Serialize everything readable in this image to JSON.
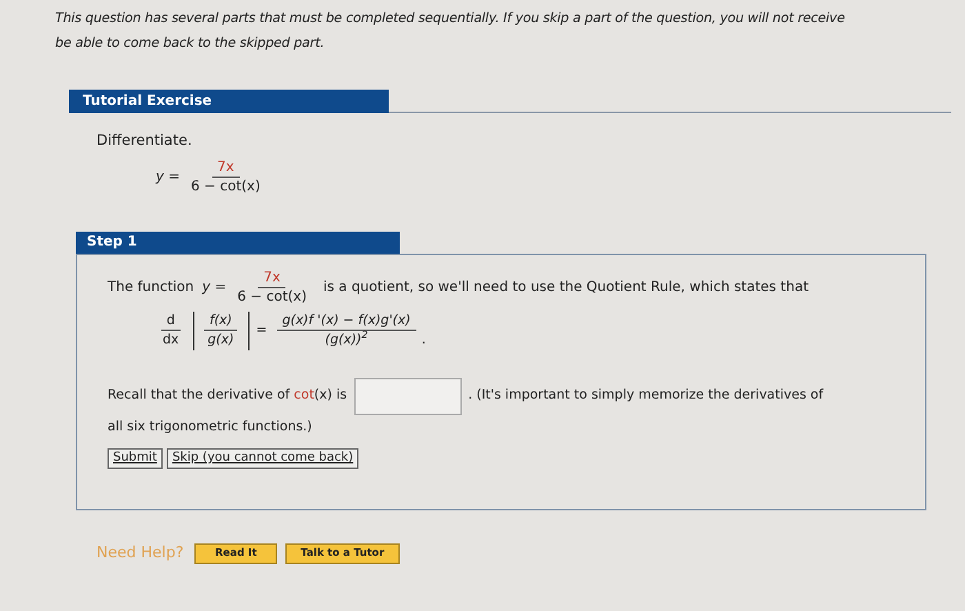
{
  "notice": [
    "This question has several parts that must be completed sequentially. If you skip a part of the question, you will not receive",
    "be able to come back to the skipped part."
  ],
  "tutorial": {
    "title": "Tutorial Exercise",
    "instruction": "Differentiate.",
    "equation": {
      "lhs": "y =",
      "numerator": "7x",
      "denominator": "6 − cot(x)"
    }
  },
  "step": {
    "title": "Step 1",
    "intro": {
      "before": "The function",
      "lhs": "y =",
      "numerator": "7x",
      "denominator": "6 − cot(x)",
      "after": "is a quotient, so we'll need to use the Quotient Rule, which states that"
    },
    "rule": {
      "d": "d",
      "dx": "dx",
      "f": "f(x)",
      "g": "g(x)",
      "equals": "=",
      "numerator": "g(x)f '(x) − f(x)g'(x)",
      "denominator": "(g(x))$^{2}$",
      "end": "."
    },
    "recall": {
      "before": "Recall that the derivative of",
      "func": "cot",
      "arg": "(x) is",
      "after": ". (It's important to simply memorize the derivatives of",
      "after_line2": "all six trigonometric functions.)"
    },
    "buttons": [
      "Submit",
      "Skip (you cannot come back)"
    ]
  },
  "help": {
    "label": "Need Help?",
    "buttons": [
      "Read It",
      "Talk to a Tutor"
    ]
  }
}
